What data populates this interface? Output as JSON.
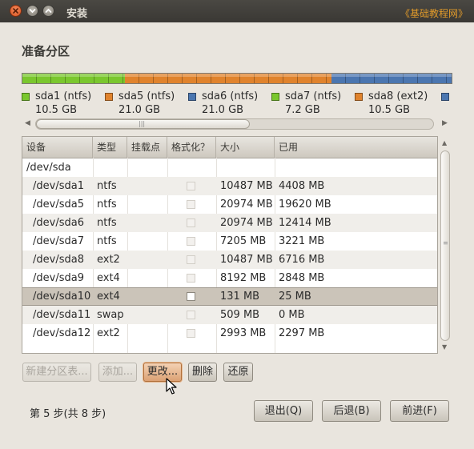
{
  "window": {
    "title": "安装",
    "watermark": "《基础教程网》"
  },
  "heading": "准备分区",
  "partition_bar": [
    {
      "name": "sda1 (ntfs)",
      "size": "10.5 GB",
      "color": "#7ac72e"
    },
    {
      "name": "sda5 (ntfs)",
      "size": "21.0 GB",
      "color": "#e0832d"
    },
    {
      "name": "sda6 (ntfs)",
      "size": "21.0 GB",
      "color": "#4b76b0"
    },
    {
      "name": "sda7 (ntfs)",
      "size": "7.2 GB",
      "color": "#7ac72e"
    },
    {
      "name": "sda8 (ext2)",
      "size": "10.5 GB",
      "color": "#e0832d"
    },
    {
      "name": "",
      "size": "",
      "color": "#4b76b0"
    }
  ],
  "table": {
    "columns": [
      "设备",
      "类型",
      "挂载点",
      "格式化？",
      "大小",
      "已用"
    ],
    "disk": "/dev/sda",
    "rows": [
      {
        "device": "/dev/sda1",
        "type": "ntfs",
        "mount": "",
        "format": false,
        "size": "10487 MB",
        "used": "4408 MB"
      },
      {
        "device": "/dev/sda5",
        "type": "ntfs",
        "mount": "",
        "format": false,
        "size": "20974 MB",
        "used": "19620 MB"
      },
      {
        "device": "/dev/sda6",
        "type": "ntfs",
        "mount": "",
        "format": false,
        "size": "20974 MB",
        "used": "12414 MB"
      },
      {
        "device": "/dev/sda7",
        "type": "ntfs",
        "mount": "",
        "format": false,
        "size": "7205 MB",
        "used": "3221 MB"
      },
      {
        "device": "/dev/sda8",
        "type": "ext2",
        "mount": "",
        "format": false,
        "size": "10487 MB",
        "used": "6716 MB"
      },
      {
        "device": "/dev/sda9",
        "type": "ext4",
        "mount": "",
        "format": false,
        "size": "8192 MB",
        "used": "2848 MB"
      },
      {
        "device": "/dev/sda10",
        "type": "ext4",
        "mount": "",
        "format": true,
        "size": "131 MB",
        "used": "25 MB",
        "selected": true
      },
      {
        "device": "/dev/sda11",
        "type": "swap",
        "mount": "",
        "format": false,
        "size": "509 MB",
        "used": "0 MB"
      },
      {
        "device": "/dev/sda12",
        "type": "ext2",
        "mount": "",
        "format": false,
        "size": "2993 MB",
        "used": "2297 MB"
      }
    ]
  },
  "actions": {
    "new_table": "新建分区表...",
    "add": "添加...",
    "change": "更改...",
    "delete": "删除",
    "revert": "还原"
  },
  "footer": {
    "step": "第 5 步(共 8 步)",
    "quit": "退出(Q)",
    "back": "后退(B)",
    "forward": "前进(F)"
  }
}
